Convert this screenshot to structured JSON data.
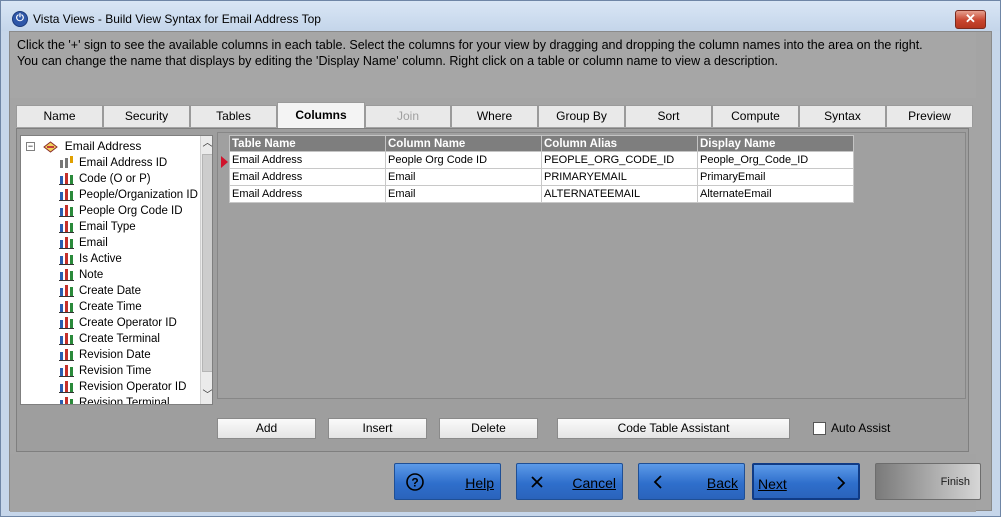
{
  "window": {
    "title": "Vista Views - Build View Syntax for Email Address Top",
    "close_glyph": "✕"
  },
  "instructions": {
    "line1": "Click the '+' sign to see the available columns in each table.  Select the columns for your view by dragging and dropping the column names into the area on the right.",
    "line2": "You can change the name that displays by editing the 'Display Name' column.  Right click on a table or column name to view a description."
  },
  "tabs": [
    {
      "label": "Name"
    },
    {
      "label": "Security"
    },
    {
      "label": "Tables"
    },
    {
      "label": "Columns"
    },
    {
      "label": "Join"
    },
    {
      "label": "Where"
    },
    {
      "label": "Group By"
    },
    {
      "label": "Sort"
    },
    {
      "label": "Compute"
    },
    {
      "label": "Syntax"
    },
    {
      "label": "Preview"
    }
  ],
  "active_tab": "Columns",
  "tree": {
    "root": "Email Address",
    "items": [
      "Email Address ID",
      "Code (O or P)",
      "People/Organization ID",
      "People Org Code ID",
      "Email Type",
      "Email",
      "Is Active",
      "Note",
      "Create Date",
      "Create Time",
      "Create Operator ID",
      "Create Terminal",
      "Revision Date",
      "Revision Time",
      "Revision Operator ID",
      "Revision Terminal"
    ]
  },
  "grid": {
    "headers": [
      "Table Name",
      "Column Name",
      "Column Alias",
      "Display Name"
    ],
    "rows": [
      [
        "Email Address",
        "People Org Code ID",
        "PEOPLE_ORG_CODE_ID",
        "People_Org_Code_ID"
      ],
      [
        "Email Address",
        "Email",
        "PRIMARYEMAIL",
        "PrimaryEmail"
      ],
      [
        "Email Address",
        "Email",
        "ALTERNATEEMAIL",
        "AlternateEmail"
      ]
    ]
  },
  "actions": {
    "add": "Add",
    "insert": "Insert",
    "delete": "Delete",
    "code_table_assistant": "Code Table Assistant",
    "auto_assist": "Auto Assist"
  },
  "nav": {
    "help": "Help",
    "cancel": "Cancel",
    "back": "Back",
    "next": "Next",
    "finish": "Finish"
  },
  "colors": {
    "nav_blue": "#2f6fcc",
    "header_gray": "#7e7e7e",
    "row_marker": "#d0142c"
  }
}
